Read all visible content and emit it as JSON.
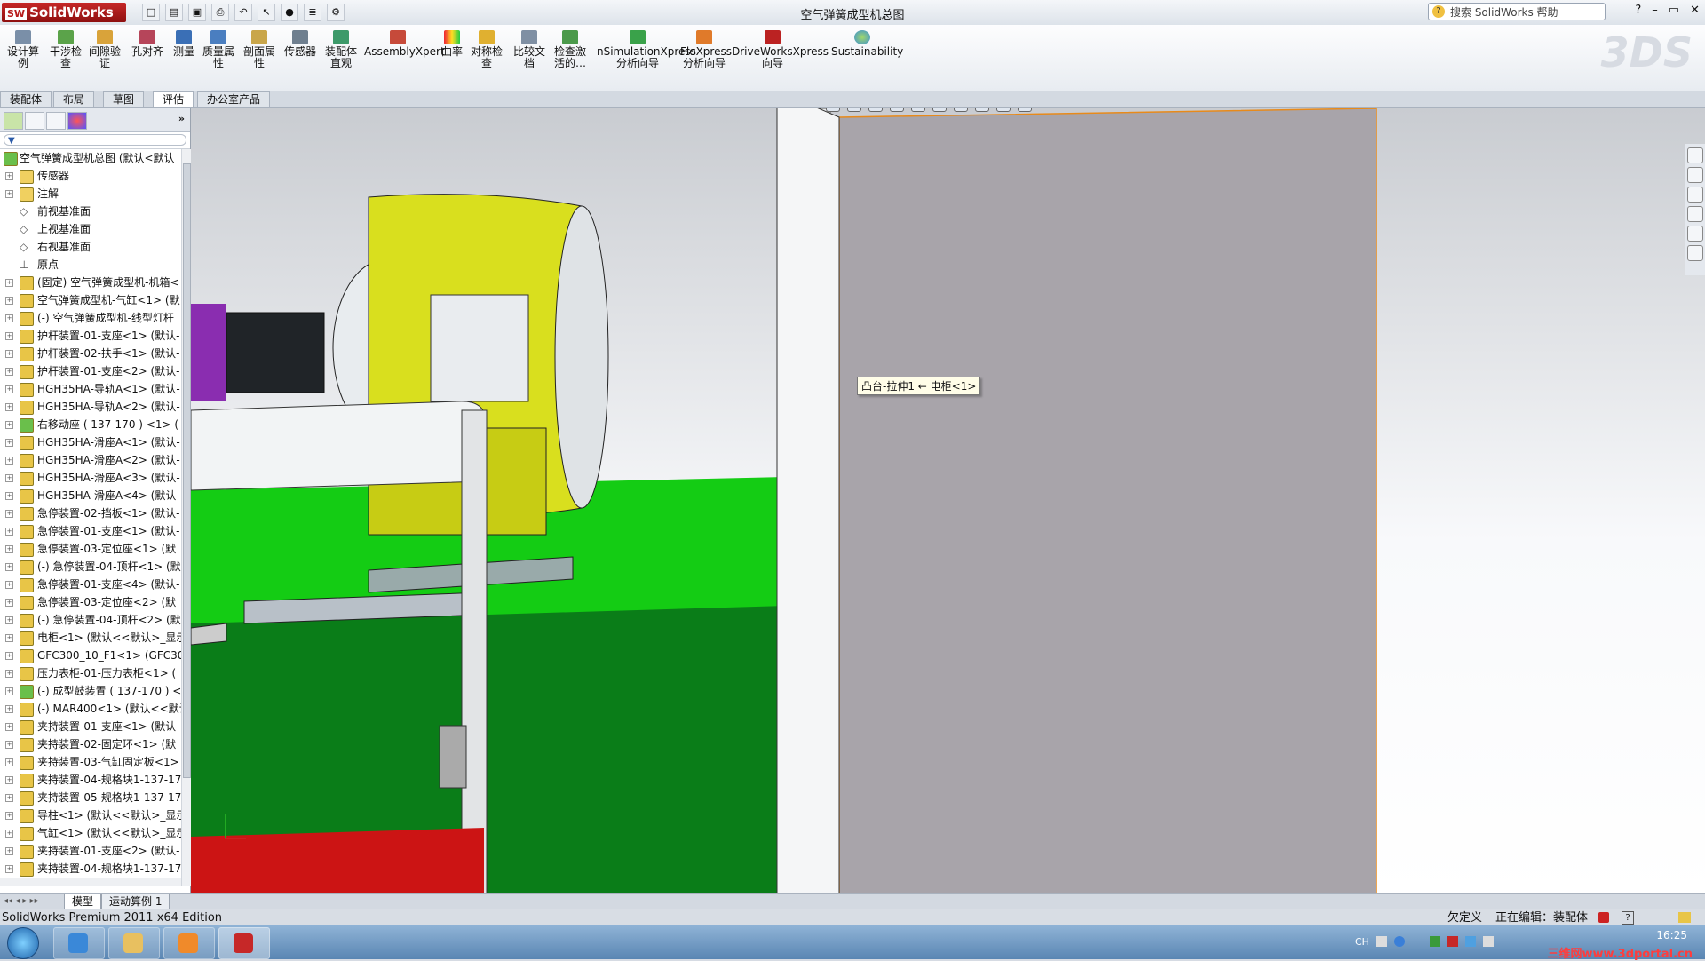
{
  "app": {
    "logo": "SolidWorks",
    "logo_badge": "SW",
    "document_title": "空气弹簧成型机总图"
  },
  "help_search": {
    "placeholder": "搜索 SolidWorks 帮助"
  },
  "window_controls": [
    "?",
    "–",
    "▭",
    "✕"
  ],
  "ribbon": {
    "buttons": [
      "设计算例",
      "干涉检查",
      "间隙验证",
      "孔对齐",
      "测量",
      "质量属性",
      "剖面属性",
      "传感器",
      "装配体直观",
      "AssemblyXpert",
      "曲率",
      "对称检查",
      "比较文档",
      "检查激活的…",
      "nSimulationXpress 分析向导",
      "FloXpress 分析向导",
      "DriveWorksXpress 向导",
      "Sustainability"
    ]
  },
  "command_tabs": [
    {
      "label": "装配体",
      "active": false
    },
    {
      "label": "布局",
      "active": false
    },
    {
      "label": "草图",
      "active": false
    },
    {
      "label": "评估",
      "active": true
    },
    {
      "label": "办公室产品",
      "active": false
    }
  ],
  "feature_tree": {
    "root": "空气弹簧成型机总图 (默认<默认",
    "items": [
      {
        "label": "传感器",
        "type": "folder"
      },
      {
        "label": "注解",
        "type": "folder"
      },
      {
        "label": "前视基准面",
        "type": "plane"
      },
      {
        "label": "上视基准面",
        "type": "plane"
      },
      {
        "label": "右视基准面",
        "type": "plane"
      },
      {
        "label": "原点",
        "type": "origin"
      },
      {
        "label": "(固定) 空气弹簧成型机-机箱<",
        "type": "part"
      },
      {
        "label": "空气弹簧成型机-气缸<1> (默",
        "type": "part"
      },
      {
        "label": "(-) 空气弹簧成型机-线型灯杆",
        "type": "part"
      },
      {
        "label": "护杆装置-01-支座<1> (默认-",
        "type": "part"
      },
      {
        "label": "护杆装置-02-扶手<1> (默认-",
        "type": "part"
      },
      {
        "label": "护杆装置-01-支座<2> (默认-",
        "type": "part"
      },
      {
        "label": "HGH35HA-导轨A<1> (默认-",
        "type": "part"
      },
      {
        "label": "HGH35HA-导轨A<2> (默认-",
        "type": "part"
      },
      {
        "label": "右移动座 ( 137-170 ) <1> (",
        "type": "assembly"
      },
      {
        "label": "HGH35HA-滑座A<1> (默认-",
        "type": "part"
      },
      {
        "label": "HGH35HA-滑座A<2> (默认-",
        "type": "part"
      },
      {
        "label": "HGH35HA-滑座A<3> (默认-",
        "type": "part"
      },
      {
        "label": "HGH35HA-滑座A<4> (默认-",
        "type": "part"
      },
      {
        "label": "急停装置-02-挡板<1> (默认-",
        "type": "part"
      },
      {
        "label": "急停装置-01-支座<1> (默认-",
        "type": "part"
      },
      {
        "label": "急停装置-03-定位座<1> (默",
        "type": "part"
      },
      {
        "label": "(-) 急停装置-04-顶杆<1> (默",
        "type": "part"
      },
      {
        "label": "急停装置-01-支座<4> (默认-",
        "type": "part"
      },
      {
        "label": "急停装置-03-定位座<2> (默",
        "type": "part"
      },
      {
        "label": "(-) 急停装置-04-顶杆<2> (默",
        "type": "part"
      },
      {
        "label": "电柜<1> (默认<<默认>_显示",
        "type": "part"
      },
      {
        "label": "GFC300_10_F1<1> (GFC300",
        "type": "part"
      },
      {
        "label": "压力表柜-01-压力表柜<1> (",
        "type": "part"
      },
      {
        "label": "(-) 成型鼓装置 ( 137-170 ) <",
        "type": "assembly"
      },
      {
        "label": "(-) MAR400<1> (默认<<默认",
        "type": "part"
      },
      {
        "label": "夹持装置-01-支座<1> (默认-",
        "type": "part"
      },
      {
        "label": "夹持装置-02-固定环<1> (默",
        "type": "part"
      },
      {
        "label": "夹持装置-03-气缸固定板<1>",
        "type": "part"
      },
      {
        "label": "夹持装置-04-规格块1-137-17",
        "type": "part"
      },
      {
        "label": "夹持装置-05-规格块1-137-17",
        "type": "part"
      },
      {
        "label": "导柱<1> (默认<<默认>_显示",
        "type": "part"
      },
      {
        "label": "气缸<1> (默认<<默认>_显示",
        "type": "part"
      },
      {
        "label": "夹持装置-01-支座<2> (默认-",
        "type": "part"
      },
      {
        "label": "夹持装置-04-规格块1-137-17",
        "type": "part"
      }
    ]
  },
  "tooltip": "凸台-拉伸1 ← 电柜<1>",
  "bottom_tabs": [
    {
      "label": "模型",
      "active": true
    },
    {
      "label": "运动算例 1",
      "active": false
    }
  ],
  "status": {
    "edition": "SolidWorks Premium 2011 x64 Edition",
    "definition": "欠定义",
    "editing": "正在编辑：装配体"
  },
  "taskbar": {
    "lang": "CH",
    "time": "16:25",
    "watermark": "三维网www.3dportal.cn"
  },
  "colors": {
    "machine_yellow": "#d9df1e",
    "base_green": "#14cc14",
    "cabinet_grey": "#a8a4aa",
    "accent_red": "#c62828"
  }
}
